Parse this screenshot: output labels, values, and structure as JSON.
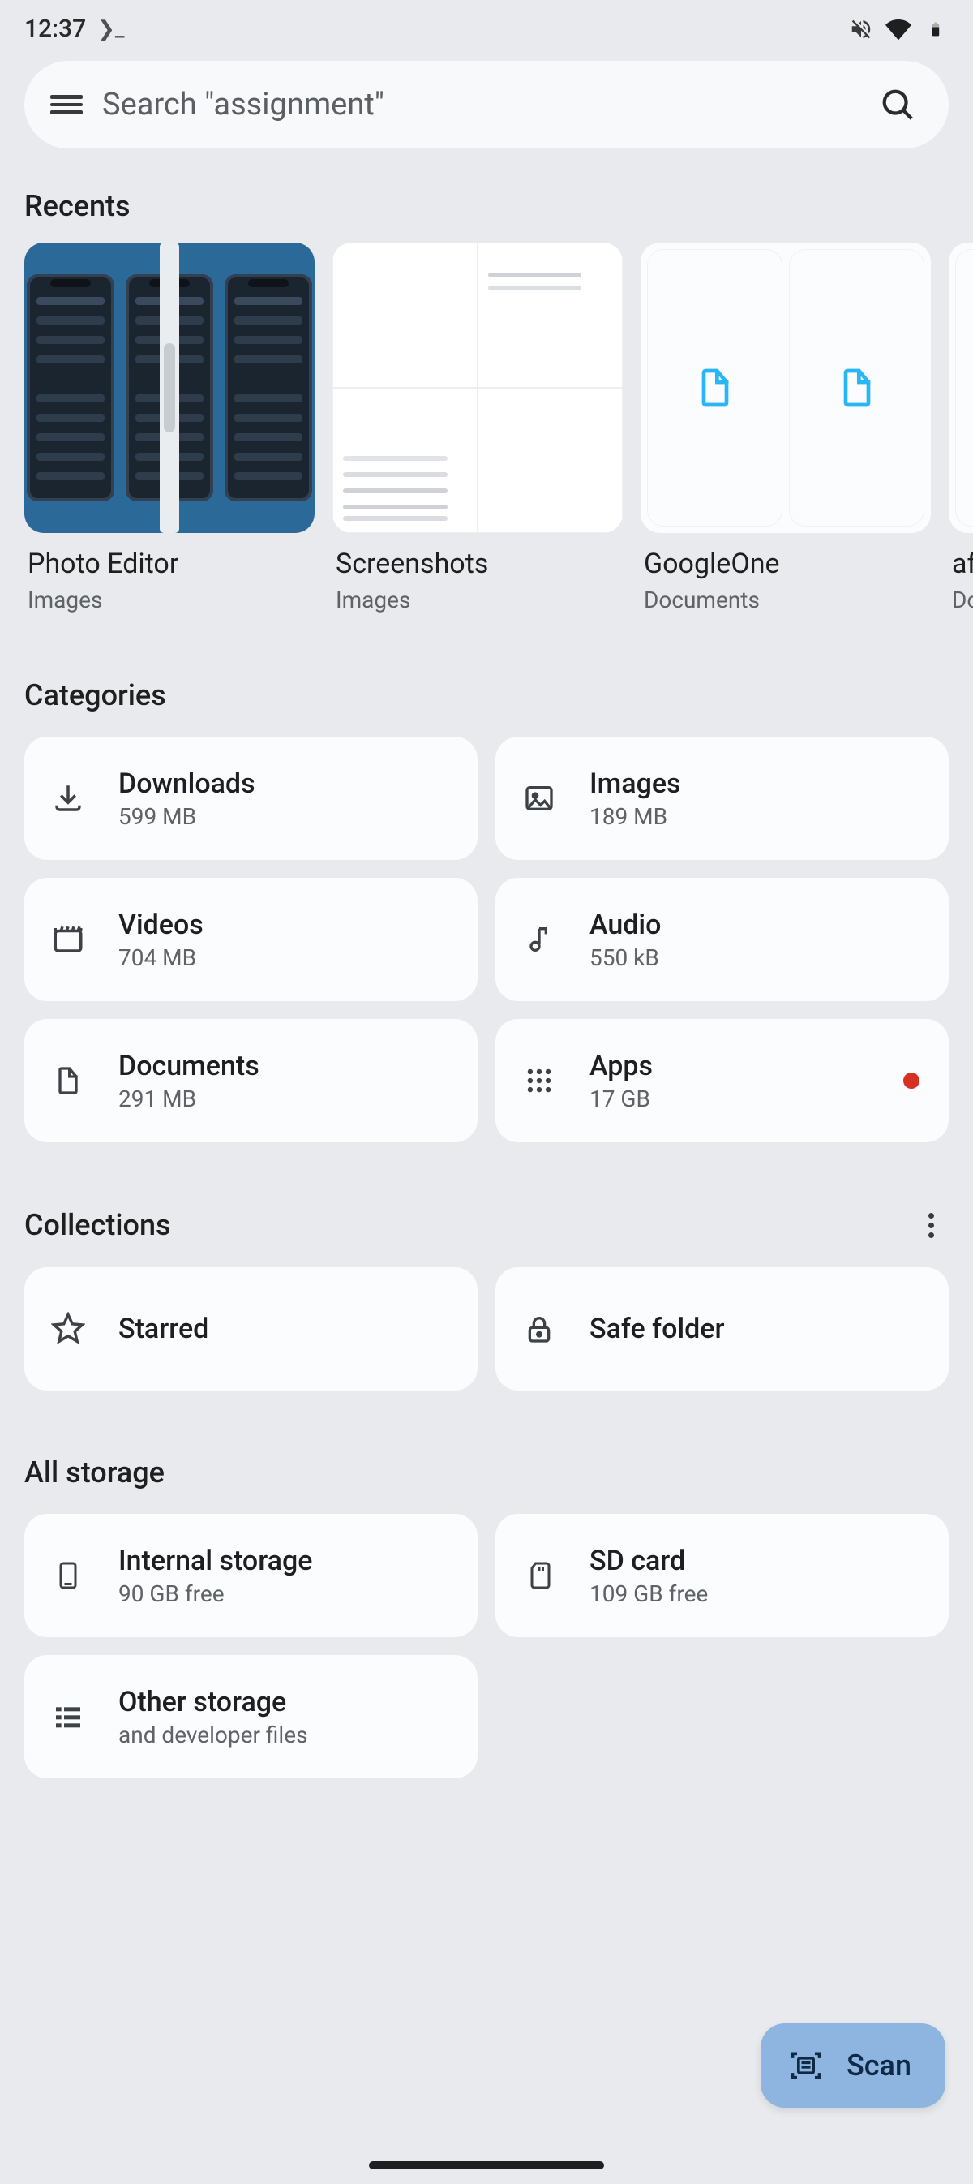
{
  "status": {
    "time": "12:37",
    "prompt_glyph": "❯_"
  },
  "search": {
    "placeholder": "Search \"assignment\""
  },
  "sections": {
    "recents": "Recents",
    "categories": "Categories",
    "collections": "Collections",
    "all_storage": "All storage"
  },
  "recents": [
    {
      "title": "Photo Editor",
      "subtitle": "Images",
      "thumb": "phones"
    },
    {
      "title": "Screenshots",
      "subtitle": "Images",
      "thumb": "docs"
    },
    {
      "title": "GoogleOne",
      "subtitle": "Documents",
      "thumb": "docpair"
    },
    {
      "title": "afla",
      "subtitle": "Doc",
      "thumb": "docpair"
    }
  ],
  "categories": [
    {
      "name": "Downloads",
      "size": "599 MB",
      "icon": "download"
    },
    {
      "name": "Images",
      "size": "189 MB",
      "icon": "image"
    },
    {
      "name": "Videos",
      "size": "704 MB",
      "icon": "movie"
    },
    {
      "name": "Audio",
      "size": "550 kB",
      "icon": "audio"
    },
    {
      "name": "Documents",
      "size": "291 MB",
      "icon": "document"
    },
    {
      "name": "Apps",
      "size": "17 GB",
      "icon": "apps",
      "badge": true
    }
  ],
  "collections": [
    {
      "name": "Starred",
      "icon": "star"
    },
    {
      "name": "Safe folder",
      "icon": "lock"
    }
  ],
  "storage": [
    {
      "name": "Internal storage",
      "sub": "90 GB free",
      "icon": "phone"
    },
    {
      "name": "SD card",
      "sub": "109 GB free",
      "icon": "sdcard"
    },
    {
      "name": "Other storage",
      "sub": "and developer files",
      "icon": "list"
    }
  ],
  "fab": {
    "label": "Scan"
  }
}
